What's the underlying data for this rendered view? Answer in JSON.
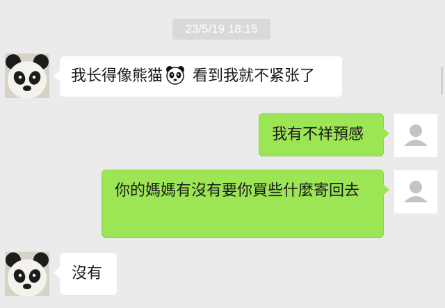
{
  "chat": {
    "timestamp": "23/5/19 18:15",
    "messages": [
      {
        "side": "left",
        "text_before": "我长得像熊猫",
        "emoji": "panda-face-icon",
        "text_after": " 看到我就不紧张了"
      },
      {
        "side": "right",
        "text": "我有不祥預感"
      },
      {
        "side": "right",
        "text": "你的媽媽有沒有要你買些什麼寄回去"
      },
      {
        "side": "left",
        "text": "沒有"
      }
    ]
  },
  "icons": {
    "contact_avatar": "panda-avatar-icon",
    "user_avatar": "default-user-icon"
  },
  "colors": {
    "background": "#ebebeb",
    "sent_bubble": "#9ce554",
    "received_bubble": "#ffffff",
    "timestamp_bg": "#d9d9d9"
  }
}
